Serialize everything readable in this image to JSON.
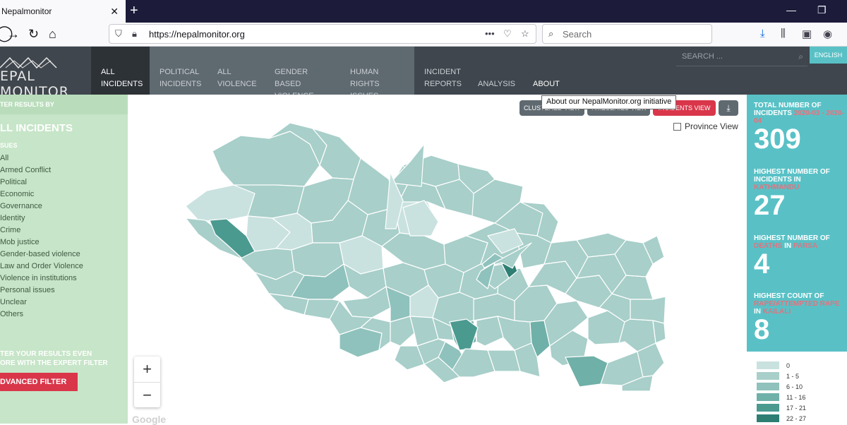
{
  "browser": {
    "tab_title": "Nepalmonitor",
    "url": "https://nepalmonitor.org",
    "search_placeholder": "Search"
  },
  "header": {
    "logo": "EPAL MONITOR",
    "menu": [
      {
        "line1": "ALL",
        "line2": "INCIDENTS"
      },
      {
        "line1": "POLITICAL",
        "line2": "INCIDENTS"
      },
      {
        "line1": "ALL",
        "line2": "VIOLENCE"
      },
      {
        "line1": "GENDER BASED",
        "line2": "VIOLENCE"
      },
      {
        "line1": "HUMAN RIGHTS",
        "line2": "ISSUES"
      },
      {
        "line1": "INCIDENT",
        "line2": "REPORTS"
      },
      {
        "line1": "ANALYSIS",
        "line2": ""
      },
      {
        "line1": "ABOUT",
        "line2": ""
      }
    ],
    "search_placeholder": "SEARCH ...",
    "language": "ENGLISH",
    "tooltip": "About our NepalMonitor.org initiative"
  },
  "sidebar": {
    "filter_heading": "TER RESULTS BY",
    "title": "LL INCIDENTS",
    "issues_label": "SUES",
    "issues": [
      "All",
      "Armed Conflict",
      "Political",
      "Economic",
      "Governance",
      "Identity",
      "Crime",
      "Mob justice",
      "Gender-based violence",
      "Law and Order Violence",
      "Violence in institutions",
      "Personal issues",
      "Unclear",
      "Others"
    ],
    "expert_line1": "TER YOUR RESULTS EVEN",
    "expert_line2": "ORE WITH THE EXPERT FILTER",
    "advanced_filter": "DVANCED FILTER"
  },
  "map": {
    "clustered": "CLUSTERED VIEW",
    "timeseries": "TIMESERIES VIEW",
    "incidents": "INCIDENTS VIEW",
    "province_view": "Province View",
    "attribution": "Google",
    "colors": [
      "#c9e2df",
      "#a8cfca",
      "#8fc2bc",
      "#6fb0a8",
      "#4b9a90",
      "#2e7e74"
    ]
  },
  "stats": {
    "total_label": "TOTAL NUMBER OF INCIDENTS",
    "total_range": "2020-03 - 2020-04",
    "total_value": "309",
    "highest_incidents_label": "HIGHEST NUMBER OF INCIDENTS IN",
    "highest_incidents_place": "KATHMANDU",
    "highest_incidents_value": "27",
    "highest_deaths_label1": "HIGHEST NUMBER OF",
    "highest_deaths_word": "DEATHS",
    "highest_deaths_in": "IN",
    "highest_deaths_place": "PARSA",
    "highest_deaths_value": "4",
    "highest_rape_label": "HIGHEST COUNT OF",
    "highest_rape_word": "RAPE/ATTEMPTED RAPE",
    "highest_rape_in": "IN",
    "highest_rape_place": "KAILALI",
    "highest_rape_value": "8"
  },
  "legend": [
    {
      "label": "0",
      "color": "#c9e2df"
    },
    {
      "label": "1 - 5",
      "color": "#a8cfca"
    },
    {
      "label": "6 - 10",
      "color": "#8fc2bc"
    },
    {
      "label": "11 - 16",
      "color": "#6fb0a8"
    },
    {
      "label": "17 - 21",
      "color": "#4b9a90"
    },
    {
      "label": "22 - 27",
      "color": "#2e7e74"
    }
  ]
}
